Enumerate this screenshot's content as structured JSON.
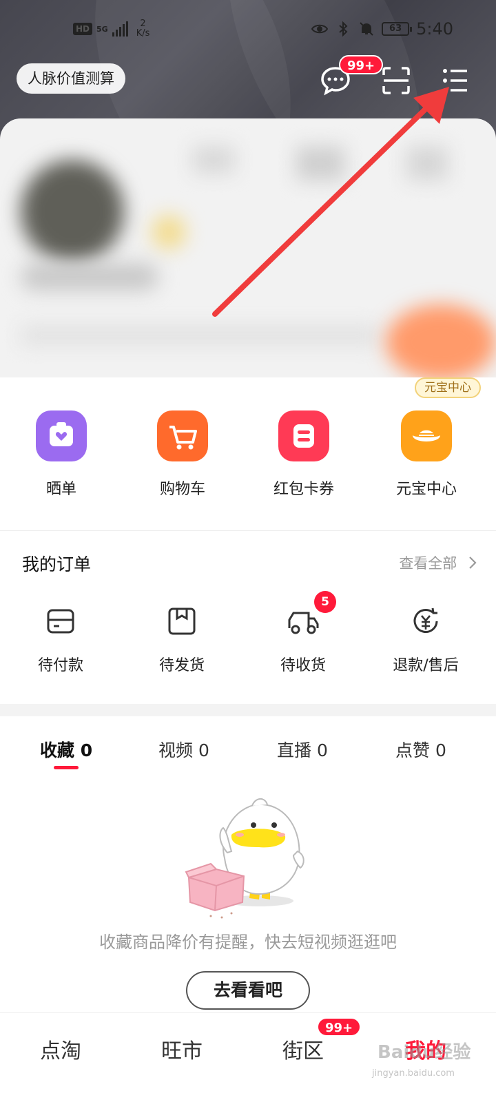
{
  "status_bar": {
    "time": "5:40",
    "battery": "63",
    "network": "5G",
    "speed_value": "2",
    "speed_unit": "K/s",
    "hd": "HD"
  },
  "header": {
    "pill_label": "人脉价值测算",
    "messages_badge": "99+"
  },
  "shortcuts": {
    "tag": "元宝中心",
    "items": [
      {
        "label": "晒单",
        "icon": "share-order-icon",
        "color": "#9b6bf0"
      },
      {
        "label": "购物车",
        "icon": "shopping-cart-icon",
        "color": "#ff6a2c"
      },
      {
        "label": "红包卡券",
        "icon": "coupon-icon",
        "color": "#ff3a55"
      },
      {
        "label": "元宝中心",
        "icon": "ingot-icon",
        "color": "#ffa21a"
      }
    ]
  },
  "orders": {
    "title": "我的订单",
    "view_all": "查看全部",
    "items": [
      {
        "label": "待付款",
        "icon": "wallet-icon"
      },
      {
        "label": "待发货",
        "icon": "package-icon"
      },
      {
        "label": "待收货",
        "icon": "delivery-truck-icon",
        "badge": "5"
      },
      {
        "label": "退款/售后",
        "icon": "refund-icon"
      }
    ]
  },
  "tabs": [
    {
      "label": "收藏",
      "count": "0",
      "active": true
    },
    {
      "label": "视频",
      "count": "0",
      "active": false
    },
    {
      "label": "直播",
      "count": "0",
      "active": false
    },
    {
      "label": "点赞",
      "count": "0",
      "active": false
    }
  ],
  "empty_state": {
    "message": "收藏商品降价有提醒，快去短视频逛逛吧",
    "button": "去看看吧"
  },
  "bottom_nav": {
    "items": [
      {
        "label": "点淘",
        "active": false
      },
      {
        "label": "旺市",
        "active": false
      },
      {
        "label": "街区",
        "active": false,
        "badge": "99+"
      },
      {
        "label": "我的",
        "active": true
      }
    ],
    "watermark": "Baidu经验",
    "watermark_sub": "jingyan.baidu.com"
  },
  "colors": {
    "accent": "#ff1a3a",
    "header_bg": "#4a4a53",
    "annotation_arrow": "#f03c3c"
  }
}
